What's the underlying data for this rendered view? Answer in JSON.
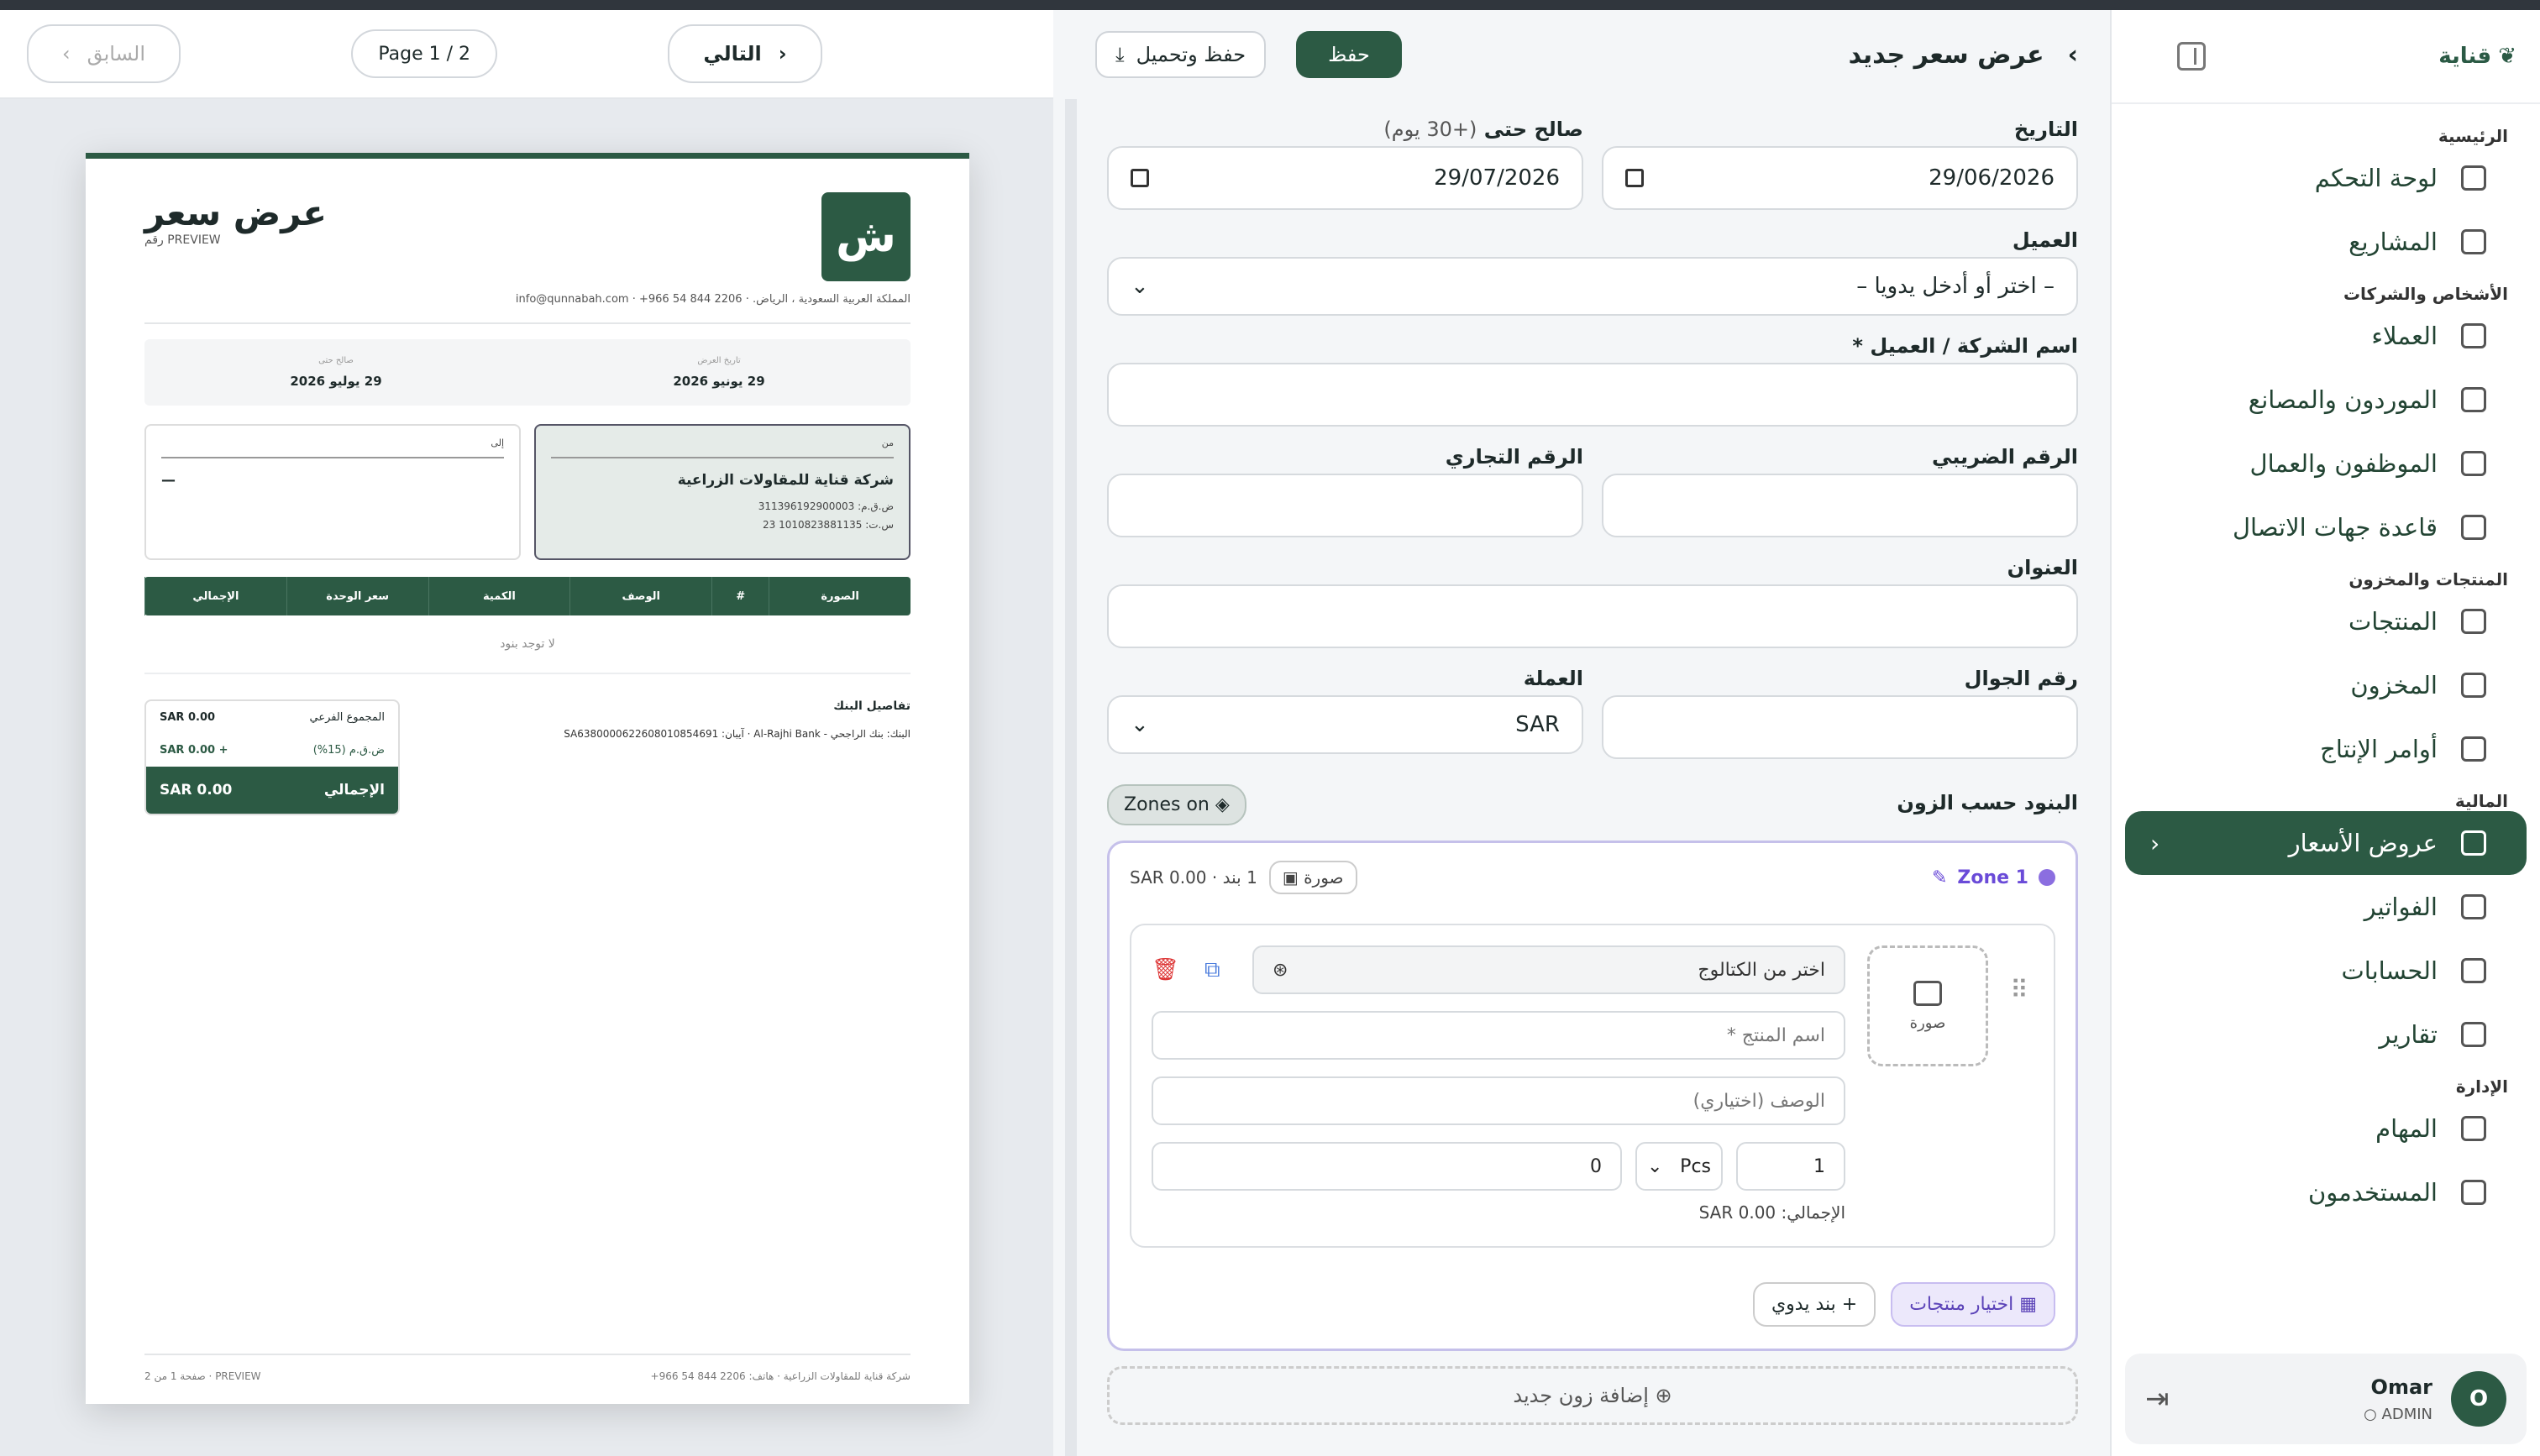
{
  "brand": {
    "name": "قناية"
  },
  "sidebar": {
    "sections": [
      {
        "title": "الرئيسية",
        "items": [
          {
            "label": "لوحة التحكم",
            "icon": "grid-icon"
          },
          {
            "label": "المشاريع",
            "icon": "projects-icon"
          }
        ]
      },
      {
        "title": "الأشخاص والشركات",
        "items": [
          {
            "label": "العملاء",
            "icon": "building-icon"
          },
          {
            "label": "الموردون والمصانع",
            "icon": "factory-icon"
          },
          {
            "label": "الموظفون والعمال",
            "icon": "user-check-icon"
          },
          {
            "label": "قاعدة جهات الاتصال",
            "icon": "book-icon"
          }
        ]
      },
      {
        "title": "المنتجات والمخزون",
        "items": [
          {
            "label": "المنتجات",
            "icon": "box-icon"
          },
          {
            "label": "المخزون",
            "icon": "warehouse-icon"
          },
          {
            "label": "أوامر الإنتاج",
            "icon": "production-icon"
          }
        ]
      },
      {
        "title": "المالية",
        "items": [
          {
            "label": "عروض الأسعار",
            "icon": "file-icon",
            "active": true
          },
          {
            "label": "الفواتير",
            "icon": "invoice-icon"
          },
          {
            "label": "الحسابات",
            "icon": "dollar-icon"
          },
          {
            "label": "تقارير",
            "icon": "chart-icon"
          }
        ]
      },
      {
        "title": "الإدارة",
        "items": [
          {
            "label": "المهام",
            "icon": "check-icon"
          },
          {
            "label": "المستخدمون",
            "icon": "users-icon"
          }
        ]
      }
    ],
    "user": {
      "initial": "O",
      "name": "Omar",
      "role": "ADMIN"
    }
  },
  "header": {
    "title": "عرض سعر جديد",
    "save": "حفظ",
    "save_download": "حفظ وتحميل"
  },
  "form": {
    "date_label": "التاريخ",
    "date": "29/06/2026",
    "valid_label": "صالح حتى",
    "valid_hint": "(+30 يوم)",
    "valid": "29/07/2026",
    "client_label": "العميل",
    "client_placeholder": "– اختر أو أدخل يدويا –",
    "company_label": "اسم الشركة / العميل *",
    "tax_label": "الرقم الضريبي",
    "cr_label": "الرقم التجاري",
    "address_label": "العنوان",
    "phone_label": "رقم الجوال",
    "currency_label": "العملة",
    "currency": "SAR",
    "zones_label": "البنود حسب الزون",
    "zones_toggle": "Zones on"
  },
  "zone": {
    "name": "Zone 1",
    "items_count": "1 بند · SAR 0.00",
    "image_chip": "صورة",
    "item": {
      "image_label": "صورة",
      "catalog": "اختر من الكتالوج",
      "name_ph": "اسم المنتج *",
      "desc_ph": "الوصف (اختياري)",
      "qty": "1",
      "unit": "Pcs",
      "price": "0",
      "total": "الإجمالي: SAR 0.00"
    },
    "pick_products": "اختيار منتجات",
    "manual_item": "بند يدوي"
  },
  "add_zone": "إضافة زون جديد",
  "preview_nav": {
    "prev": "السابق",
    "page": "Page 1 / 2",
    "next": "التالي"
  },
  "doc": {
    "logo": "ش",
    "title": "عرض سعر",
    "subtitle": "رقم PREVIEW",
    "contact": "المملكة العربية السعودية ، الرياض. · 2206 844 54 966+ · info@qunnabah.com",
    "date_lbl": "تاريخ العرض",
    "date": "29 يونيو 2026",
    "valid_lbl": "صالح حتى",
    "valid": "29 يوليو 2026",
    "from_lbl": "من",
    "from_name": "شركة قناية للمقاولات الزراعية",
    "from_vat": "ض.ق.م: 311396192900003",
    "from_cr": "س.ت: 1010823881135 23",
    "to_lbl": "إلى",
    "to_name": "—",
    "cols": [
      "الصورة",
      "#",
      "الوصف",
      "الكمية",
      "سعر الوحدة",
      "الإجمالي"
    ],
    "empty": "لا توجد بنود",
    "bank_title": "تفاصيل البنك",
    "bank_line": "البنك: بنك الراجحي - Al-Rajhi Bank · آيبان: SA6380000622608010854691",
    "subtotal_lbl": "المجموع الفرعي",
    "subtotal": "SAR 0.00",
    "vat_lbl": "ض.ق.م (15%)",
    "vat": "+ SAR 0.00",
    "grand_lbl": "الإجمالي",
    "grand": "SAR 0.00",
    "footer_r": "شركة قناية للمقاولات الزراعية · هاتف: 2206 844 54 966+",
    "footer_l": "PREVIEW · صفحة 1 من 2"
  }
}
